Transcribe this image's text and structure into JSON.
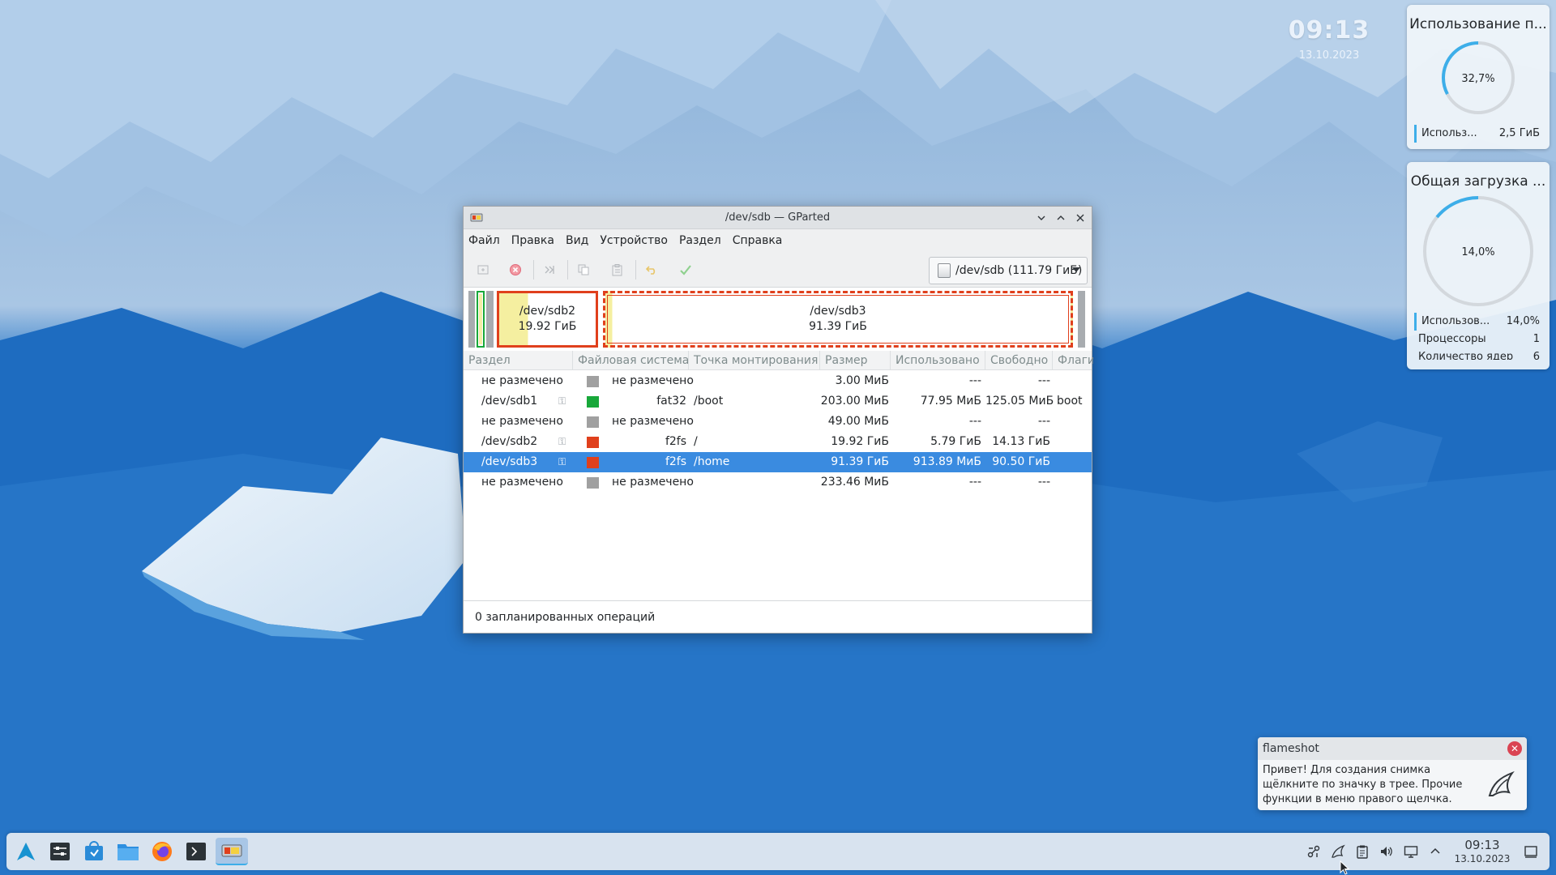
{
  "desktop": {
    "clock_time": "09:13",
    "clock_date": "13.10.2023"
  },
  "widgets": {
    "memory": {
      "title": "Использование п...",
      "percent_label": "32,7%",
      "percent_value": 32.7,
      "row_label": "Использ...",
      "row_value": "2,5 ГиБ"
    },
    "cpu": {
      "title": "Общая загрузка ...",
      "percent_label": "14,0%",
      "percent_value": 14.0,
      "rows": [
        {
          "label": "Использов...",
          "value": "14,0%"
        },
        {
          "label": "Процессоры",
          "value": "1"
        },
        {
          "label": "Количество ядер",
          "value": "6"
        }
      ]
    }
  },
  "window": {
    "title": "/dev/sdb — GParted",
    "menu": [
      "Файл",
      "Правка",
      "Вид",
      "Устройство",
      "Раздел",
      "Справка"
    ],
    "toolbar_icons": [
      "new-partition-icon",
      "delete-icon",
      "resize-move-icon",
      "copy-icon",
      "paste-icon",
      "undo-icon",
      "apply-icon"
    ],
    "device_selector": "/dev/sdb (111.79 ГиБ)",
    "diskmap": {
      "sdb2": {
        "name": "/dev/sdb2",
        "size": "19.92 ГиБ"
      },
      "sdb3": {
        "name": "/dev/sdb3",
        "size": "91.39 ГиБ"
      }
    },
    "columns": [
      "Раздел",
      "Файловая система",
      "Точка монтирования",
      "Размер",
      "Использовано",
      "Свободно",
      "Флаги"
    ],
    "rows": [
      {
        "partition": "не размечено",
        "key": false,
        "color": "#a0a0a0",
        "fs": "не размечено",
        "mount": "",
        "size": "3.00 МиБ",
        "used": "---",
        "free": "---",
        "flags": ""
      },
      {
        "partition": "/dev/sdb1",
        "key": true,
        "color": "#18a83a",
        "fs": "fat32",
        "mount": "/boot",
        "size": "203.00 МиБ",
        "used": "77.95 МиБ",
        "free": "125.05 МиБ",
        "flags": "boot"
      },
      {
        "partition": "не размечено",
        "key": false,
        "color": "#a0a0a0",
        "fs": "не размечено",
        "mount": "",
        "size": "49.00 МиБ",
        "used": "---",
        "free": "---",
        "flags": ""
      },
      {
        "partition": "/dev/sdb2",
        "key": true,
        "color": "#e0401c",
        "fs": "f2fs",
        "mount": "/",
        "size": "19.92 ГиБ",
        "used": "5.79 ГиБ",
        "free": "14.13 ГиБ",
        "flags": ""
      },
      {
        "partition": "/dev/sdb3",
        "key": true,
        "color": "#e0401c",
        "fs": "f2fs",
        "mount": "/home",
        "size": "91.39 ГиБ",
        "used": "913.89 МиБ",
        "free": "90.50 ГиБ",
        "flags": ""
      },
      {
        "partition": "не размечено",
        "key": false,
        "color": "#a0a0a0",
        "fs": "не размечено",
        "mount": "",
        "size": "233.46 МиБ",
        "used": "---",
        "free": "---",
        "flags": ""
      }
    ],
    "selected_row": 4,
    "status": "0 запланированных операций"
  },
  "notification": {
    "app": "flameshot",
    "message": "Привет! Для создания снимка щёлкните по значку в трее. Прочие функции в меню правого щелчка."
  },
  "taskbar": {
    "apps": [
      "launcher-icon",
      "settings-icon",
      "discover-icon",
      "dolphin-icon",
      "firefox-icon",
      "konsole-icon",
      "gparted-icon"
    ],
    "tray": [
      "network-icon",
      "flameshot-icon",
      "clipboard-icon",
      "volume-icon",
      "display-icon",
      "tray-expand-icon"
    ],
    "clock_time": "09:13",
    "clock_date": "13.10.2023"
  },
  "colors": {
    "accent": "#3daee9",
    "selection": "#3a8be0",
    "f2fs": "#e0401c",
    "fat32": "#18a83a",
    "unallocated": "#a0a0a0"
  }
}
